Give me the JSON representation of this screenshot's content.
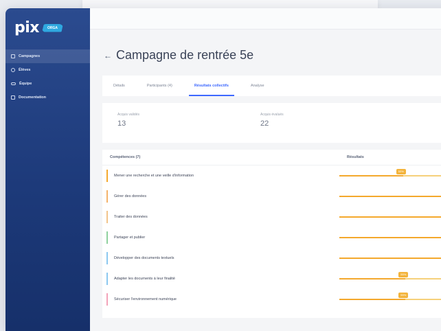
{
  "app": {
    "logo_text": "pix",
    "logo_badge": "ORGA"
  },
  "sidebar": {
    "items": [
      {
        "label": "Campagnes",
        "active": true,
        "icon": "grid-icon"
      },
      {
        "label": "Élèves",
        "active": false,
        "icon": "users-icon"
      },
      {
        "label": "Équipe",
        "active": false,
        "icon": "team-icon"
      },
      {
        "label": "Documentation",
        "active": false,
        "icon": "document-icon"
      }
    ]
  },
  "page": {
    "title": "Campagne de rentrée 5e",
    "back_arrow": "←"
  },
  "tabs": [
    {
      "label": "Détails",
      "active": false
    },
    {
      "label": "Participants (4)",
      "active": false
    },
    {
      "label": "Résultats collectifs",
      "active": true
    },
    {
      "label": "Analyse",
      "active": false
    }
  ],
  "stats": [
    {
      "label": "Acquis validés",
      "value": "13"
    },
    {
      "label": "Acquis évalués",
      "value": "22"
    }
  ],
  "table": {
    "headers": {
      "competences": "Compétences (7)",
      "results": "Résultats"
    },
    "rows": [
      {
        "label": "Mener une recherche et une veille d'information",
        "color": "#f4a82c",
        "progress": 0.53,
        "badge": "53%"
      },
      {
        "label": "Gérer des données",
        "color": "#f4b36a",
        "progress": 1.0,
        "badge": ""
      },
      {
        "label": "Traiter des données",
        "color": "#f2c48a",
        "progress": 1.0,
        "badge": ""
      },
      {
        "label": "Partager et publier",
        "color": "#8fd19e",
        "progress": 1.0,
        "badge": ""
      },
      {
        "label": "Développer des documents textuels",
        "color": "#8cc8f0",
        "progress": 1.0,
        "badge": ""
      },
      {
        "label": "Adapter les documents à leur finalité",
        "color": "#8cc8f0",
        "progress": 0.55,
        "badge": "55%"
      },
      {
        "label": "Sécuriser l'environnement numérique",
        "color": "#f3a3b9",
        "progress": 0.55,
        "badge": "55%"
      }
    ]
  },
  "colors": {
    "accent": "#3d68ff",
    "sidebar": "#1d3a7a",
    "progress": "#f4a82c"
  }
}
